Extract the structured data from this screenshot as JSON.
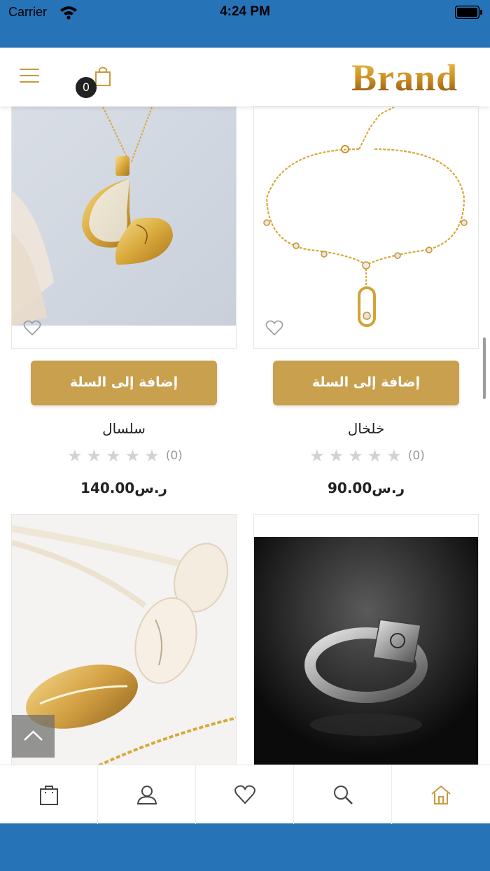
{
  "status_bar": {
    "carrier": "Carrier",
    "time": "4:24 PM"
  },
  "header": {
    "brand": "Brand",
    "cart_count": "0"
  },
  "products": [
    {
      "name": "سلسال",
      "add_label": "إضافة إلى السلة",
      "rating_count": "(0)",
      "price": "ر.س140.00"
    },
    {
      "name": "خلخال",
      "add_label": "إضافة إلى السلة",
      "rating_count": "(0)",
      "price": "ر.س90.00"
    }
  ],
  "colors": {
    "accent": "#c9a04e",
    "status_blue": "#2773b8",
    "star_empty": "#d2d2d2"
  },
  "icons": {
    "bottom_nav": [
      "bag-icon",
      "user-icon",
      "heart-icon",
      "search-icon",
      "home-icon"
    ],
    "header": [
      "menu-icon",
      "cart-icon"
    ]
  }
}
